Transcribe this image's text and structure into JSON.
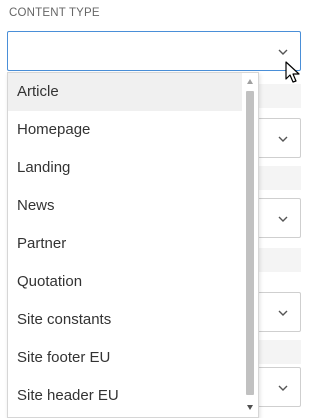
{
  "field": {
    "label": "CONTENT TYPE",
    "value": ""
  },
  "dropdown": {
    "options": [
      {
        "label": "Article",
        "selected": true
      },
      {
        "label": "Homepage",
        "selected": false
      },
      {
        "label": "Landing",
        "selected": false
      },
      {
        "label": "News",
        "selected": false
      },
      {
        "label": "Partner",
        "selected": false
      },
      {
        "label": "Quotation",
        "selected": false
      },
      {
        "label": "Site constants",
        "selected": false
      },
      {
        "label": "Site footer EU",
        "selected": false
      },
      {
        "label": "Site header EU",
        "selected": false
      }
    ]
  },
  "icons": {
    "select_chevron": "chevron-down-icon",
    "cursor": "mouse-pointer-icon",
    "scroll_up": "scroll-up-arrow-icon",
    "scroll_down": "scroll-down-arrow-icon"
  },
  "colors": {
    "focus_border": "#4a8fd8",
    "selected_option_bg": "#f0f0f0",
    "text": "#333333",
    "label_text": "#666666"
  }
}
